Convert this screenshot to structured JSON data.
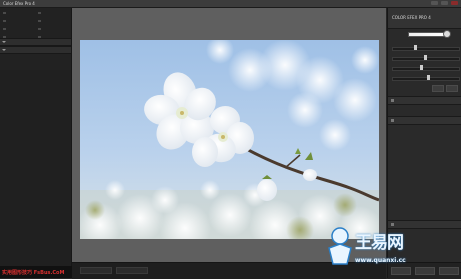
{
  "window": {
    "title": "Color Efex Pro 4"
  },
  "left_panel": {
    "filters": [
      "",
      "",
      "",
      "",
      "",
      "",
      "",
      ""
    ],
    "sections": [
      {
        "label": ""
      },
      {
        "label": ""
      }
    ]
  },
  "right_panel": {
    "header_small": "",
    "filter_name": "COLOR EFEX PRO 4",
    "header_sub": "",
    "sliders": [
      {
        "label": "",
        "value": 0.35
      },
      {
        "label": "",
        "value": 0.5
      },
      {
        "label": "",
        "value": 0.45
      },
      {
        "label": "",
        "value": 0.55
      }
    ],
    "sections": [
      {
        "label": ""
      },
      {
        "label": ""
      },
      {
        "label": ""
      }
    ],
    "bottom_buttons": [
      "",
      "",
      ""
    ]
  },
  "watermark": {
    "brand": "王易网",
    "url": "www.quanxi.cc"
  },
  "logo": {
    "text": "实用图形技巧 FsBus.CoM"
  },
  "colors": {
    "accent": "#2a7fc8",
    "logo_red": "#d93030"
  },
  "icons": [
    "close-icon",
    "minimize-icon",
    "maximize-icon",
    "collapse-arrow-icon"
  ]
}
